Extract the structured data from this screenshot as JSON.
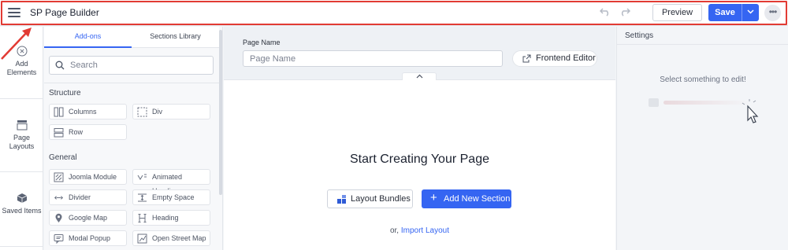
{
  "topbar": {
    "title": "SP Page Builder",
    "preview_label": "Preview",
    "save_label": "Save"
  },
  "rail": {
    "items": [
      {
        "label": "Add Elements",
        "icon": "close-circle-icon"
      },
      {
        "label": "Page Layouts",
        "icon": "layout-icon"
      },
      {
        "label": "Saved Items",
        "icon": "box-icon"
      }
    ]
  },
  "panel": {
    "tabs": [
      {
        "label": "Add-ons",
        "active": true
      },
      {
        "label": "Sections Library",
        "active": false
      }
    ],
    "search_placeholder": "Search",
    "sections": [
      {
        "title": "Structure",
        "items": [
          {
            "label": "Columns",
            "icon": "columns-icon"
          },
          {
            "label": "Div",
            "icon": "div-icon"
          },
          {
            "label": "Row",
            "icon": "row-icon"
          }
        ]
      },
      {
        "title": "General",
        "items": [
          {
            "label": "Joomla Module",
            "icon": "joomla-module-icon"
          },
          {
            "label": "Animated Heading",
            "icon": "animated-heading-icon"
          },
          {
            "label": "Divider",
            "icon": "divider-icon"
          },
          {
            "label": "Empty Space",
            "icon": "empty-space-icon"
          },
          {
            "label": "Google Map",
            "icon": "map-pin-icon"
          },
          {
            "label": "Heading",
            "icon": "heading-icon"
          },
          {
            "label": "Modal Popup",
            "icon": "modal-popup-icon"
          },
          {
            "label": "Open Street Map",
            "icon": "open-street-map-icon"
          }
        ]
      }
    ]
  },
  "canvas": {
    "page_name_label": "Page Name",
    "page_name_placeholder": "Page Name",
    "page_name_value": "",
    "frontend_editor_label": "Frontend Editor",
    "start_title": "Start Creating Your Page",
    "layout_bundles_label": "Layout Bundles",
    "add_section_label": "Add New Section",
    "import_prefix": "or,",
    "import_link": "Import Layout"
  },
  "settings": {
    "title": "Settings",
    "empty_message": "Select something to edit!"
  },
  "colors": {
    "accent": "#3565f2",
    "highlight": "#e23b34"
  }
}
